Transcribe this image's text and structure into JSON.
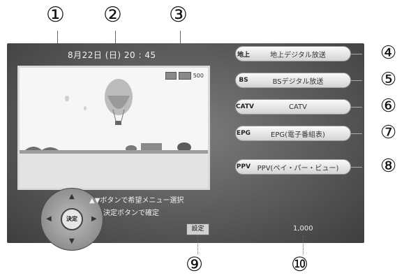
{
  "callouts": {
    "c1": "①",
    "c2": "②",
    "c3": "③",
    "c4": "④",
    "c5": "⑤",
    "c6": "⑥",
    "c7": "⑦",
    "c8": "⑧",
    "c9": "⑨",
    "c10": "⑩"
  },
  "header": {
    "datetime": "8月22日 (日) 20 : 45"
  },
  "preview": {
    "channel_number": "500"
  },
  "menu": [
    {
      "icon": "地上",
      "label": "地上デジタル放送"
    },
    {
      "icon": "BS",
      "label": "BSデジタル放送"
    },
    {
      "icon": "CATV",
      "label": "CATV"
    },
    {
      "icon": "EPG",
      "label": "EPG(電子番組表)"
    },
    {
      "icon": "PPV",
      "label": "PPV(ペイ・パー・ビュー)"
    }
  ],
  "hints": {
    "select": "▲▼ボタンで希望メニュー選択",
    "confirm": "決定ボタンで確定"
  },
  "controller": {
    "center_label": "決定"
  },
  "footer": {
    "settings_label": "設定",
    "points": "1,000"
  }
}
